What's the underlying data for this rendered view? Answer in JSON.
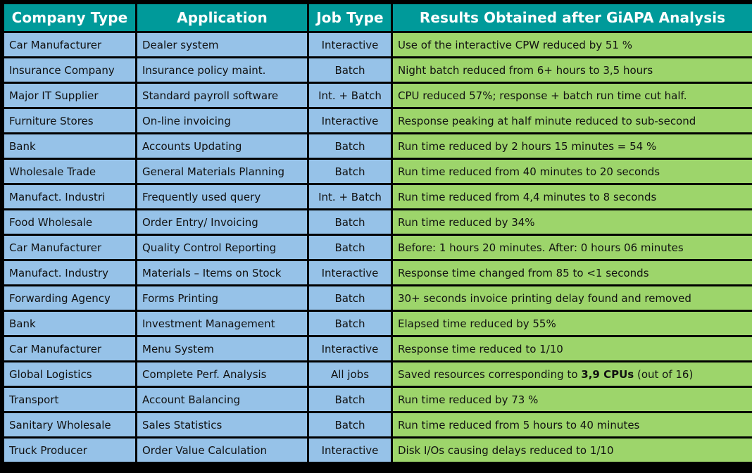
{
  "table": {
    "columns": [
      {
        "key": "company_type",
        "label": "Company Type"
      },
      {
        "key": "application",
        "label": "Application"
      },
      {
        "key": "job_type",
        "label": "Job Type"
      },
      {
        "key": "results",
        "label": "Results Obtained after GiAPA Analysis"
      }
    ],
    "colors": {
      "header_background": "#009A9A",
      "header_text": "#FFFFFF",
      "cell_background_blue": "#96C2E8",
      "cell_background_green": "#9DD56B",
      "grid_line": "#000000",
      "cell_text": "#111111"
    },
    "rows": [
      {
        "company_type": "Car Manufacturer",
        "application": "Dealer system",
        "job_type": "Interactive",
        "results": "Use of the interactive CPW   reduced by 51 %"
      },
      {
        "company_type": "Insurance Company",
        "application": "Insurance policy maint.",
        "job_type": "Batch",
        "results": "Night batch reduced from 6+ hours to 3,5 hours"
      },
      {
        "company_type": "Major IT Supplier",
        "application": "Standard payroll software",
        "job_type": "Int. + Batch",
        "results": "CPU reduced 57%;  response + batch run time cut half."
      },
      {
        "company_type": "Furniture Stores",
        "application": "On-line invoicing",
        "job_type": "Interactive",
        "results": "Response peaking at half minute reduced to sub-second"
      },
      {
        "company_type": "Bank",
        "application": "Accounts Updating",
        "job_type": "Batch",
        "results": "Run time reduced by 2 hours 15 minutes = 54 %"
      },
      {
        "company_type": "Wholesale Trade",
        "application": "General Materials Planning",
        "job_type": "Batch",
        "results": "Run time reduced from 40 minutes to 20 seconds"
      },
      {
        "company_type": "Manufact. Industri",
        "application": "Frequently used query",
        "job_type": "Int. + Batch",
        "results": "Run time reduced from 4,4 minutes to 8 seconds"
      },
      {
        "company_type": "Food Wholesale",
        "application": "Order Entry/ Invoicing",
        "job_type": "Batch",
        "results": "Run time reduced by 34%"
      },
      {
        "company_type": "Car Manufacturer",
        "application": "Quality Control Reporting",
        "job_type": "Batch",
        "results": "Before: 1 hours 20 minutes. After:  0 hours 06 minutes"
      },
      {
        "company_type": "Manufact. Industry",
        "application": "Materials – Items on Stock",
        "job_type": "Interactive",
        "results": "Response time changed  from 85 to <1 seconds"
      },
      {
        "company_type": "Forwarding Agency",
        "application": "Forms Printing",
        "job_type": "Batch",
        "results": "30+ seconds invoice printing delay found and removed"
      },
      {
        "company_type": "Bank",
        "application": "Investment Management",
        "job_type": "Batch",
        "results": "Elapsed time reduced by 55%"
      },
      {
        "company_type": "Car Manufacturer",
        "application": "Menu System",
        "job_type": "Interactive",
        "results": "Response time reduced to 1/10"
      },
      {
        "company_type": "Global Logistics",
        "application": "Complete Perf. Analysis",
        "job_type": "All jobs",
        "results_parts": [
          {
            "text": "Saved resources corresponding to ",
            "bold": false
          },
          {
            "text": "3,9 CPUs",
            "bold": true
          },
          {
            "text": " (out of 16)",
            "bold": false
          }
        ],
        "results": "Saved resources corresponding to 3,9 CPUs (out of 16)"
      },
      {
        "company_type": "Transport",
        "application": "Account Balancing",
        "job_type": "Batch",
        "results": "Run time reduced by 73 %"
      },
      {
        "company_type": "Sanitary Wholesale",
        "application": "Sales Statistics",
        "job_type": "Batch",
        "results": "Run time reduced from 5 hours to 40 minutes"
      },
      {
        "company_type": "Truck Producer",
        "application": "Order Value Calculation",
        "job_type": "Interactive",
        "results": "Disk I/Os causing delays  reduced to 1/10"
      }
    ]
  }
}
